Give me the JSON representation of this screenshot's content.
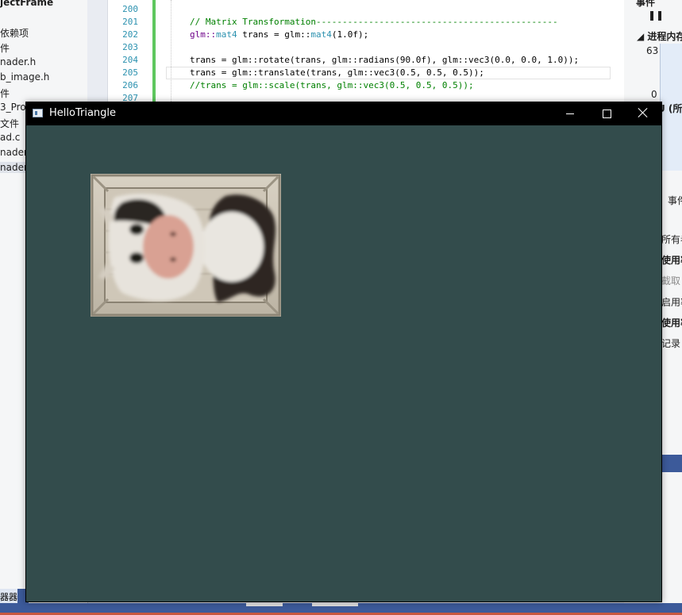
{
  "solution_explorer": {
    "items": [
      {
        "label": "jectFrame"
      },
      {
        "label": "依赖项"
      },
      {
        "label": "件"
      },
      {
        "label": "nader.h"
      },
      {
        "label": "b_image.h"
      },
      {
        "label": "件"
      },
      {
        "label": "3_Pro"
      },
      {
        "label": "文件"
      },
      {
        "label": "ad.c"
      },
      {
        "label": "nader."
      },
      {
        "label": "nader."
      }
    ],
    "bottom_tab": "器器"
  },
  "editor": {
    "lines": [
      {
        "number": "200",
        "code": ""
      },
      {
        "number": "201",
        "comment": "// Matrix Transformation----------------------------------------------"
      },
      {
        "number": "202",
        "ns": "glm::",
        "type": "mat4",
        "rest": " trans = glm::",
        "type2": "mat4",
        "rest2": "(1.0f);"
      },
      {
        "number": "203",
        "code": ""
      },
      {
        "number": "204",
        "code": "trans = glm::rotate(trans, glm::radians(90.0f), glm::vec3(0.0, 0.0, 1.0));"
      },
      {
        "number": "205",
        "code": "trans = glm::translate(trans, glm::vec3(0.5, 0.5, 0.5));"
      },
      {
        "number": "206",
        "comment": "//trans = glm::scale(trans, glm::vec3(0.5, 0.5, 0.5));"
      },
      {
        "number": "207",
        "code": ""
      }
    ]
  },
  "diagnostics": {
    "events_title": "事件",
    "memory_title": "进程内存",
    "graph_max": "63",
    "graph_min": "0",
    "cpu_label": "U (所",
    "tab_label": "事件",
    "options": [
      "所有者",
      "使用率",
      "截取",
      "启用率",
      "使用率",
      "记录"
    ]
  },
  "app_window": {
    "title": "HelloTriangle",
    "min_symbol": "—",
    "max_symbol": "☐",
    "close_symbol": "✕",
    "clear_color": "#334c4c"
  },
  "colors": {
    "ide_background": "#e9ecf2",
    "accent_blue": "#3c5a9a",
    "change_bar": "#5ec75e",
    "line_number": "#2b91af",
    "comment": "#008000"
  }
}
